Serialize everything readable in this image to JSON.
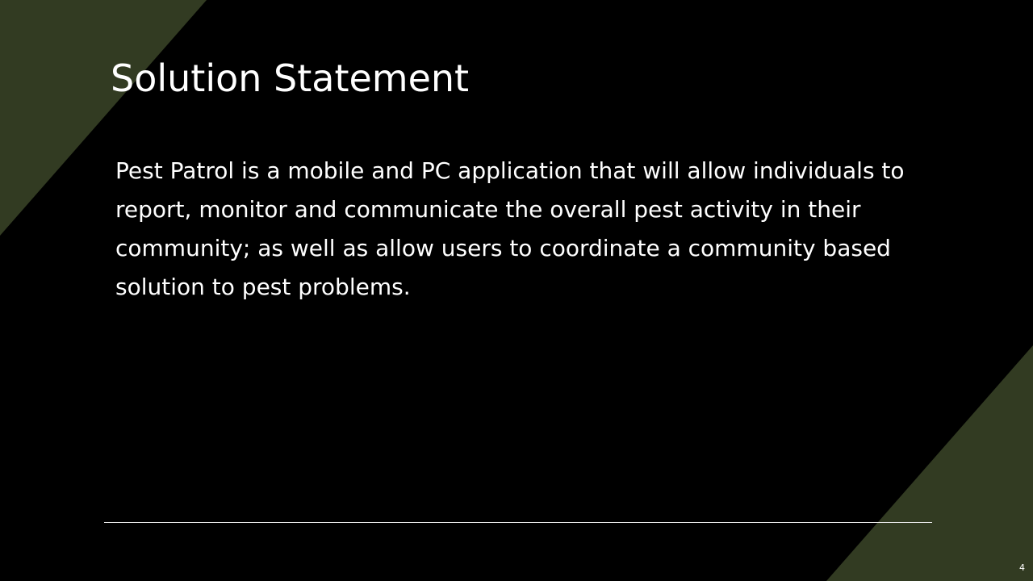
{
  "slide": {
    "title": "Solution Statement",
    "body": "Pest Patrol is a mobile and PC application that will allow individuals to report, monitor and communicate the overall pest activity in their community; as well as allow users to coordinate a community based solution to pest problems.",
    "page_number": "4"
  },
  "colors": {
    "background": "#000000",
    "accent_shape": "#323b22",
    "text": "#ffffff"
  }
}
